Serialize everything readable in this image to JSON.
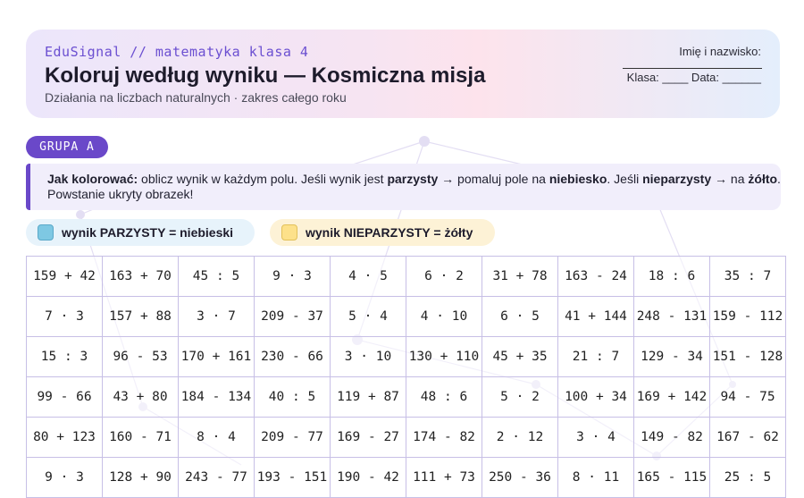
{
  "header": {
    "brand": "EduSignal // matematyka klasa 4",
    "title": "Koloruj według wyniku — Kosmiczna misja",
    "subtitle": "Działania na liczbach naturalnych · zakres całego roku",
    "name_label": "Imię i nazwisko:",
    "class_date": "Klasa: ____ Data: ______"
  },
  "group_label": "GRUPA A",
  "instructions": {
    "lead": "Jak kolorować:",
    "part1": " oblicz wynik w każdym polu. Jeśli wynik jest ",
    "even_word": "parzysty",
    "part2": " → pomaluj pole na ",
    "blue_word": "niebiesko",
    "part3": ". Jeśli ",
    "odd_word": "nieparzysty",
    "part4": " → na ",
    "yellow_word": "żółto",
    "part5": ". Powstanie ukryty obrazek!"
  },
  "legend": {
    "even": "wynik PARZYSTY = niebieski",
    "odd": "wynik NIEPARZYSTY = żółty",
    "even_color": "#7ec8e3",
    "odd_color": "#fde18a"
  },
  "accent_color": "#6a48c9",
  "grid": [
    [
      "159 + 42",
      "163 + 70",
      "45 : 5",
      "9 · 3",
      "4 · 5",
      "6 · 2",
      "31 + 78",
      "163 - 24",
      "18 : 6",
      "35 : 7"
    ],
    [
      "7 · 3",
      "157 + 88",
      "3 · 7",
      "209 - 37",
      "5 · 4",
      "4 · 10",
      "6 · 5",
      "41 + 144",
      "248 - 131",
      "159 - 112"
    ],
    [
      "15 : 3",
      "96 - 53",
      "170 + 161",
      "230 - 66",
      "3 · 10",
      "130 + 110",
      "45 + 35",
      "21 : 7",
      "129 - 34",
      "151 - 128"
    ],
    [
      "99 - 66",
      "43 + 80",
      "184 - 134",
      "40 : 5",
      "119 + 87",
      "48 : 6",
      "5 · 2",
      "100 + 34",
      "169 + 142",
      "94 - 75"
    ],
    [
      "80 + 123",
      "160 - 71",
      "8 · 4",
      "209 - 77",
      "169 - 27",
      "174 - 82",
      "2 · 12",
      "3 · 4",
      "149 - 82",
      "167 - 62"
    ],
    [
      "9 · 3",
      "128 + 90",
      "243 - 77",
      "193 - 151",
      "190 - 42",
      "111 + 73",
      "250 - 36",
      "8 · 11",
      "165 - 115",
      "25 : 5"
    ]
  ]
}
